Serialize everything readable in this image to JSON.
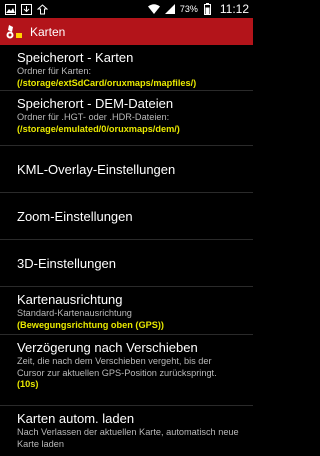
{
  "status": {
    "battery": "73%",
    "time": "11:12"
  },
  "appbar": {
    "title": "Karten"
  },
  "settings": [
    {
      "title": "Speicherort - Karten",
      "summary": "Ordner für Karten:",
      "value": "(/storage/extSdCard/oruxmaps/mapfiles/)"
    },
    {
      "title": "Speicherort - DEM-Dateien",
      "summary": "Ordner für .HGT- oder .HDR-Dateien:",
      "value": "(/storage/emulated/0/oruxmaps/dem/)"
    },
    {
      "title": "KML-Overlay-Einstellungen"
    },
    {
      "title": "Zoom-Einstellungen"
    },
    {
      "title": "3D-Einstellungen"
    },
    {
      "title": "Kartenausrichtung",
      "summary": "Standard-Kartenausrichtung",
      "value": "(Bewegungsrichtung oben (GPS))"
    },
    {
      "title": "Verzögerung nach Verschieben",
      "summary": "Zeit, die nach dem Verschieben vergeht, bis der Cursor zur aktuellen GPS-Position zurückspringt.",
      "value": "(10s)"
    },
    {
      "title": "Karten autom. laden",
      "summary": "Nach Verlassen der aktuellen Karte, automatisch neue Karte laden"
    }
  ]
}
